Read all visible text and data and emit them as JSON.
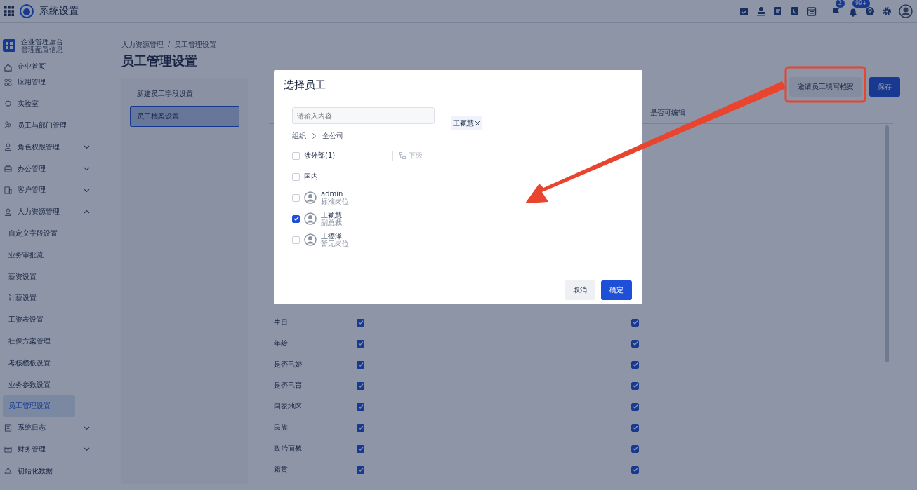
{
  "app_bar": {
    "title": "系统设置",
    "flag_badge": "2",
    "bell_badge": "99+"
  },
  "sidebar": {
    "org_name": "企业管理后台",
    "org_subtitle": "管理配置信息",
    "items": [
      {
        "kind": "link",
        "label": "企业首页"
      },
      {
        "kind": "link",
        "label": "应用管理"
      },
      {
        "kind": "link",
        "label": "实验室"
      },
      {
        "kind": "link",
        "label": "员工与部门管理"
      },
      {
        "kind": "group",
        "label": "角色权限管理",
        "expanded": false
      },
      {
        "kind": "group",
        "label": "办公管理",
        "expanded": false
      },
      {
        "kind": "group",
        "label": "客户管理",
        "expanded": false
      },
      {
        "kind": "group",
        "label": "人力资源管理",
        "expanded": true,
        "children": [
          {
            "label": "自定义字段设置",
            "selected": false
          },
          {
            "label": "业务审批流",
            "selected": false
          },
          {
            "label": "薪资设置",
            "selected": false
          },
          {
            "label": "计薪设置",
            "selected": false
          },
          {
            "label": "工资表设置",
            "selected": false
          },
          {
            "label": "社保方案管理",
            "selected": false
          },
          {
            "label": "考核模板设置",
            "selected": false
          },
          {
            "label": "业务参数设置",
            "selected": false
          },
          {
            "label": "员工管理设置",
            "selected": true
          }
        ]
      },
      {
        "kind": "group",
        "label": "系统日志",
        "expanded": false
      },
      {
        "kind": "group",
        "label": "财务管理",
        "expanded": false
      },
      {
        "kind": "link",
        "label": "初始化数据"
      }
    ]
  },
  "breadcrumb": [
    "人力资源管理",
    "员工管理设置"
  ],
  "breadcrumb_separator": "/",
  "page_title": "员工管理设置",
  "settings_nav": [
    {
      "label": "新建员工字段设置",
      "selected": false
    },
    {
      "label": "员工档案设置",
      "selected": true
    }
  ],
  "actions": {
    "invite_button": "邀请员工填写档案",
    "save_button": "保存"
  },
  "field_table": {
    "column_header": "是否可编辑",
    "rows": [
      {
        "field": "生日",
        "column_2_checked": true,
        "editable_checked": true
      },
      {
        "field": "年龄",
        "column_2_checked": true,
        "editable_checked": true
      },
      {
        "field": "是否已婚",
        "column_2_checked": true,
        "editable_checked": true
      },
      {
        "field": "是否已育",
        "column_2_checked": true,
        "editable_checked": true
      },
      {
        "field": "国家地区",
        "column_2_checked": true,
        "editable_checked": true
      },
      {
        "field": "民族",
        "column_2_checked": true,
        "editable_checked": true
      },
      {
        "field": "政治面貌",
        "column_2_checked": true,
        "editable_checked": true
      },
      {
        "field": "籍贯",
        "column_2_checked": true,
        "editable_checked": true
      }
    ]
  },
  "modal": {
    "title": "选择员工",
    "search": {
      "placeholder": "请输入内容"
    },
    "path": [
      "组织",
      "全公司"
    ],
    "departments": [
      {
        "label": "涉外部(1)",
        "checked": false,
        "sub_link": "下级"
      },
      {
        "label": "国内",
        "checked": false
      }
    ],
    "employees": [
      {
        "name": "admin",
        "position": "标准岗位",
        "checked": false
      },
      {
        "name": "王颖慧",
        "position": "副总裁",
        "checked": true
      },
      {
        "name": "王德泽",
        "position": "暂无岗位",
        "checked": false
      }
    ],
    "selected_tags": [
      {
        "label": "王颖慧"
      }
    ],
    "cancel_button": "取消",
    "confirm_button": "确定"
  }
}
